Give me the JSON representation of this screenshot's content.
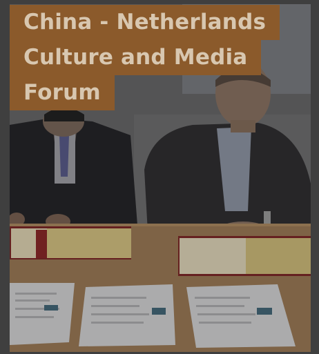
{
  "article": {
    "title_lines": [
      "China - Netherlands",
      "Culture and Media",
      "Forum"
    ]
  },
  "colors": {
    "title_banner": "#8b5a2b",
    "title_text": "#d8c7b0",
    "overlay": "#2a2a2a"
  },
  "image": {
    "subject": "signing-ceremony-photo"
  }
}
